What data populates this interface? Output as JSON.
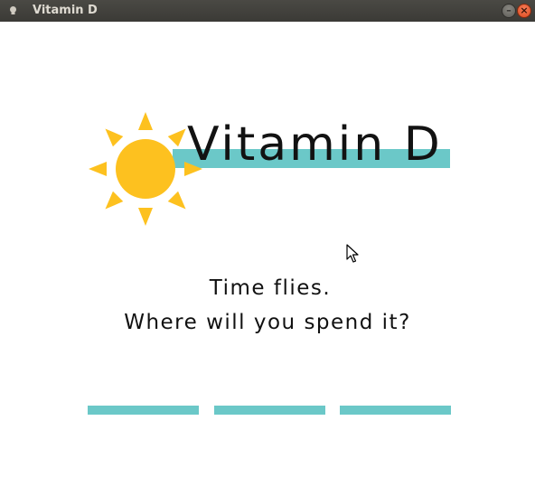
{
  "window": {
    "title": "Vitamin D",
    "minimize_glyph": "–",
    "close_glyph": "×"
  },
  "logo": {
    "title": "Vitamin D",
    "icon": "sun-icon"
  },
  "tagline": {
    "line1": "Time flies.",
    "line2": "Where will you spend it?"
  },
  "nav": {
    "items": [
      "nav-option-1",
      "nav-option-2",
      "nav-option-3"
    ]
  },
  "colors": {
    "titlebar": "#3b3a36",
    "accent": "#6bc8c8",
    "sun": "#fdc11f",
    "text": "#111111",
    "close_button": "#e55a30",
    "background": "#ffffff"
  }
}
